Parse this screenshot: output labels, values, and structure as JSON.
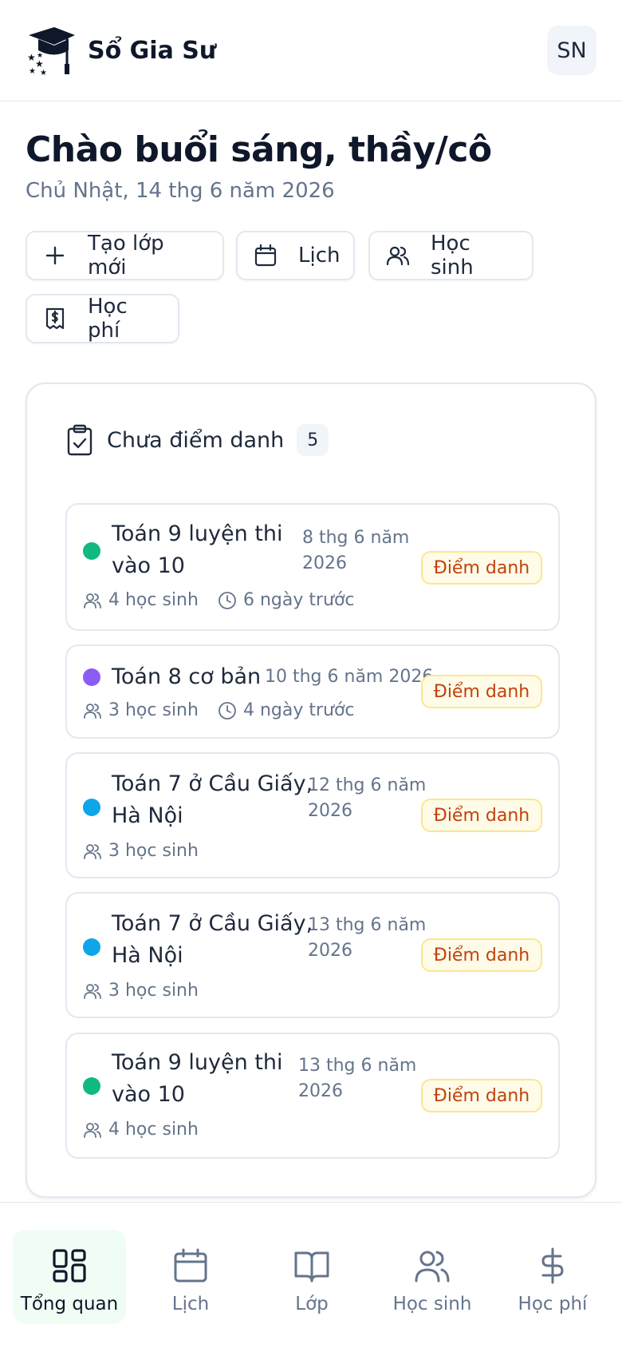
{
  "app": {
    "name": "Sổ Gia Sư",
    "avatar_initials": "SN"
  },
  "greeting": {
    "title": "Chào buổi sáng, thầy/cô",
    "date": "Chủ Nhật, 14 thg 6 năm 2026"
  },
  "quick_actions": {
    "new_class": "Tạo lớp mới",
    "calendar": "Lịch",
    "students": "Học sinh",
    "fees": "Học phí"
  },
  "attendance": {
    "title": "Chưa điểm danh",
    "count": "5",
    "button_label": "Điểm danh",
    "items": [
      {
        "name_line1": "Toán 9 luyện thi",
        "name_line2": "vào 10",
        "date_line1": "8 thg 6 năm",
        "date_line2": "2026",
        "students": "4 học sinh",
        "ago": "6 ngày trước",
        "color": "#10b981"
      },
      {
        "name_line1": "Toán 8 cơ bản",
        "date_line1": "10 thg 6 năm 2026",
        "students": "3 học sinh",
        "ago": "4 ngày trước",
        "color": "#8b5cf6"
      },
      {
        "name_line1": "Toán 7 ở Cầu Giấy,",
        "name_line2": "Hà Nội",
        "date_line1": "12 thg 6 năm",
        "date_line2": "2026",
        "students": "3 học sinh",
        "color": "#0ea5e9"
      },
      {
        "name_line1": "Toán 7 ở Cầu Giấy,",
        "name_line2": "Hà Nội",
        "date_line1": "13 thg 6 năm",
        "date_line2": "2026",
        "students": "3 học sinh",
        "color": "#0ea5e9"
      },
      {
        "name_line1": "Toán 9 luyện thi",
        "name_line2": "vào 10",
        "date_line1": "13 thg 6 năm",
        "date_line2": "2026",
        "students": "4 học sinh",
        "color": "#10b981"
      }
    ]
  },
  "nav": {
    "overview": "Tổng quan",
    "calendar": "Lịch",
    "classes": "Lớp",
    "students": "Học sinh",
    "fees": "Học phí"
  },
  "colors": {
    "active_nav_bg": "#f0fdf4",
    "attendance_button_bg": "#fefce8",
    "attendance_button_text": "#c2410c"
  }
}
